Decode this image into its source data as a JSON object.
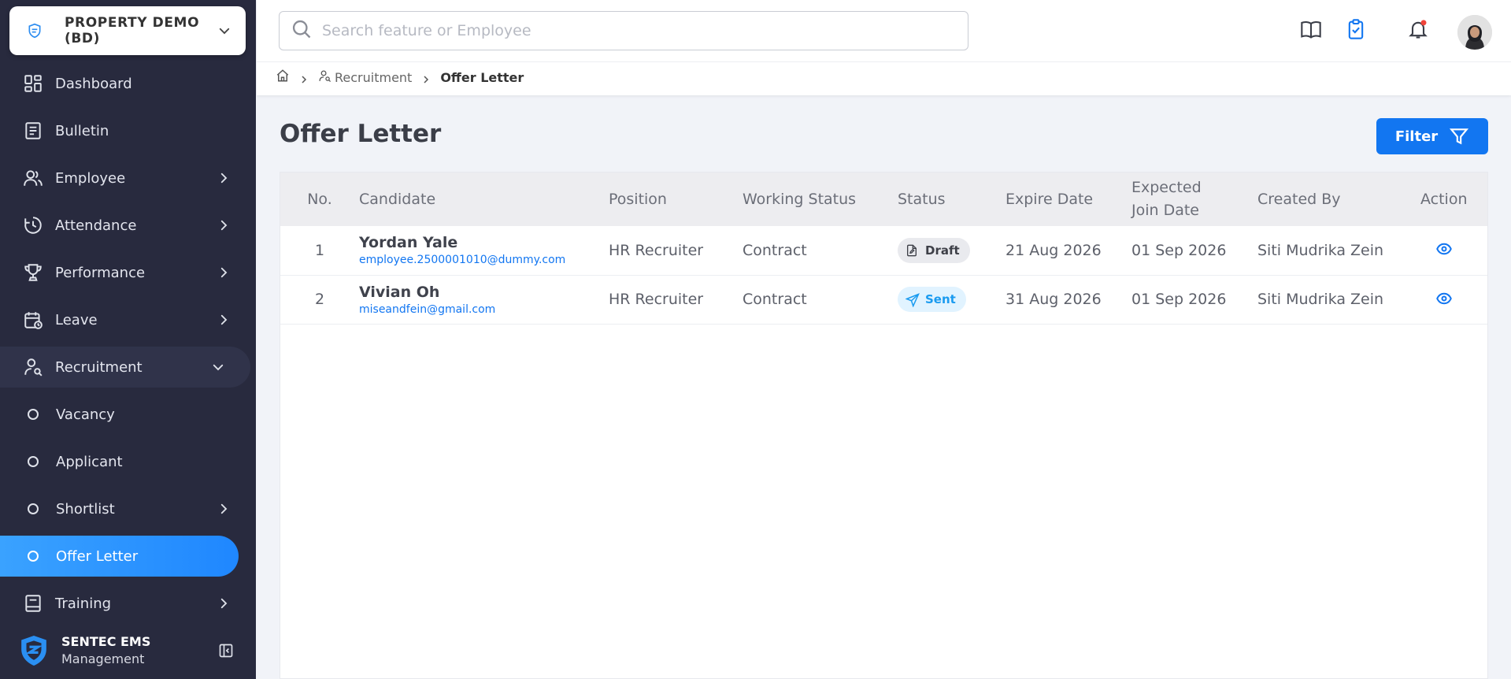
{
  "company": {
    "name": "PROPERTY DEMO (BD)"
  },
  "sidebar": {
    "items": [
      {
        "label": "Dashboard",
        "icon": "dashboard-icon"
      },
      {
        "label": "Bulletin",
        "icon": "bulletin-icon"
      },
      {
        "label": "Employee",
        "icon": "employee-icon",
        "has_children": true
      },
      {
        "label": "Attendance",
        "icon": "attendance-icon",
        "has_children": true
      },
      {
        "label": "Performance",
        "icon": "trophy-icon",
        "has_children": true
      },
      {
        "label": "Leave",
        "icon": "calendar-icon",
        "has_children": true
      },
      {
        "label": "Recruitment",
        "icon": "recruitment-icon",
        "expanded": true
      },
      {
        "label": "Vacancy"
      },
      {
        "label": "Applicant"
      },
      {
        "label": "Shortlist",
        "has_children": true
      },
      {
        "label": "Offer Letter",
        "active": true
      },
      {
        "label": "Training",
        "icon": "training-icon",
        "has_children": true
      }
    ]
  },
  "brand": {
    "title": "SENTEC EMS",
    "subtitle": "Management"
  },
  "header": {
    "search_placeholder": "Search feature or Employee",
    "icons": [
      "book-icon",
      "clipboard-check-icon",
      "bell-icon",
      "avatar"
    ],
    "notification_dot_color": "#f0443a"
  },
  "breadcrumb": {
    "items": [
      "Recruitment",
      "Offer Letter"
    ]
  },
  "page": {
    "title": "Offer Letter",
    "filter_label": "Filter"
  },
  "table": {
    "columns": {
      "no": "No.",
      "candidate": "Candidate",
      "position": "Position",
      "working_status": "Working Status",
      "status": "Status",
      "expire_date": "Expire Date",
      "expected_join_1": "Expected",
      "expected_join_2": "Join Date",
      "created_by": "Created By",
      "action": "Action"
    },
    "rows": [
      {
        "no": "1",
        "name": "Yordan Yale",
        "email": "employee.2500001010@dummy.com",
        "position": "HR Recruiter",
        "working_status": "Contract",
        "status": "Draft",
        "expire_date": "21 Aug 2026",
        "join_date": "01 Sep 2026",
        "created_by": "Siti Mudrika Zein"
      },
      {
        "no": "2",
        "name": "Vivian Oh",
        "email": "miseandfein@gmail.com",
        "position": "HR Recruiter",
        "working_status": "Contract",
        "status": "Sent",
        "expire_date": "31 Aug 2026",
        "join_date": "01 Sep 2026",
        "created_by": "Siti Mudrika Zein"
      }
    ]
  },
  "colors": {
    "sidebar_bg": "#282a3e",
    "accent": "#1276f1",
    "active_item": "#2a92ff"
  }
}
